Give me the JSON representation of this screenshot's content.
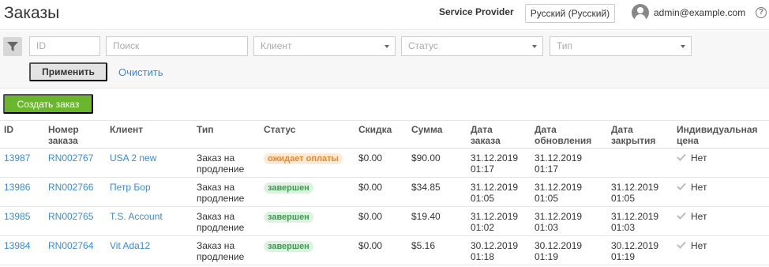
{
  "header": {
    "title": "Заказы",
    "provider": "Service Provider",
    "language": "Русский (Русский)",
    "user_email": "admin@example.com",
    "help_symbol": "?"
  },
  "filters": {
    "id_placeholder": "ID",
    "search_placeholder": "Поиск",
    "client_placeholder": "Клиент",
    "status_placeholder": "Статус",
    "type_placeholder": "Тип",
    "apply_label": "Применить",
    "clear_label": "Очистить"
  },
  "actions": {
    "create_order_label": "Создать заказ"
  },
  "table": {
    "headers": {
      "id": "ID",
      "number": "Номер заказа",
      "client": "Клиент",
      "type": "Тип",
      "status": "Статус",
      "discount": "Скидка",
      "sum": "Сумма",
      "order_date": "Дата заказа",
      "update_date": "Дата обновления",
      "close_date": "Дата закрытия",
      "individual_price": "Индивидуальная цена"
    },
    "rows": [
      {
        "id": "13987",
        "number": "RN002767",
        "client": "USA 2 new",
        "type": "Заказ на продление",
        "status": "ожидает оплаты",
        "status_kind": "pending",
        "discount": "$0.00",
        "sum": "$90.00",
        "order_date": "31.12.2019 01:17",
        "update_date": "31.12.2019 01:17",
        "close_date": "",
        "individual_price": "Нет"
      },
      {
        "id": "13986",
        "number": "RN002766",
        "client": "Петр Бор",
        "type": "Заказ на продление",
        "status": "завершен",
        "status_kind": "done",
        "discount": "$0.00",
        "sum": "$34.85",
        "order_date": "31.12.2019 01:05",
        "update_date": "31.12.2019 01:05",
        "close_date": "31.12.2019 01:05",
        "individual_price": "Нет"
      },
      {
        "id": "13985",
        "number": "RN002765",
        "client": "T.S. Account",
        "type": "Заказ на продление",
        "status": "завершен",
        "status_kind": "done",
        "discount": "$0.00",
        "sum": "$19.40",
        "order_date": "31.12.2019 01:02",
        "update_date": "31.12.2019 01:03",
        "close_date": "31.12.2019 01:03",
        "individual_price": "Нет"
      },
      {
        "id": "13984",
        "number": "RN002764",
        "client": "Vit Ada12",
        "type": "Заказ на продление",
        "status": "завершен",
        "status_kind": "done",
        "discount": "$0.00",
        "sum": "$5.16",
        "order_date": "30.12.2019 01:18",
        "update_date": "30.12.2019 01:19",
        "close_date": "30.12.2019 01:19",
        "individual_price": "Нет"
      }
    ]
  },
  "colors": {
    "accent_link": "#3d8ad1",
    "create_button": "#6ab72d",
    "pending_badge_bg": "#fde9d6",
    "pending_badge_text": "#e58a2b",
    "done_badge_bg": "#ddf2e1",
    "done_badge_text": "#3e9a4e"
  },
  "icons": {
    "filter": "funnel-icon",
    "avatar": "user-avatar-icon",
    "help": "help-icon",
    "check": "check-icon",
    "dropdown": "chevron-down-icon"
  }
}
